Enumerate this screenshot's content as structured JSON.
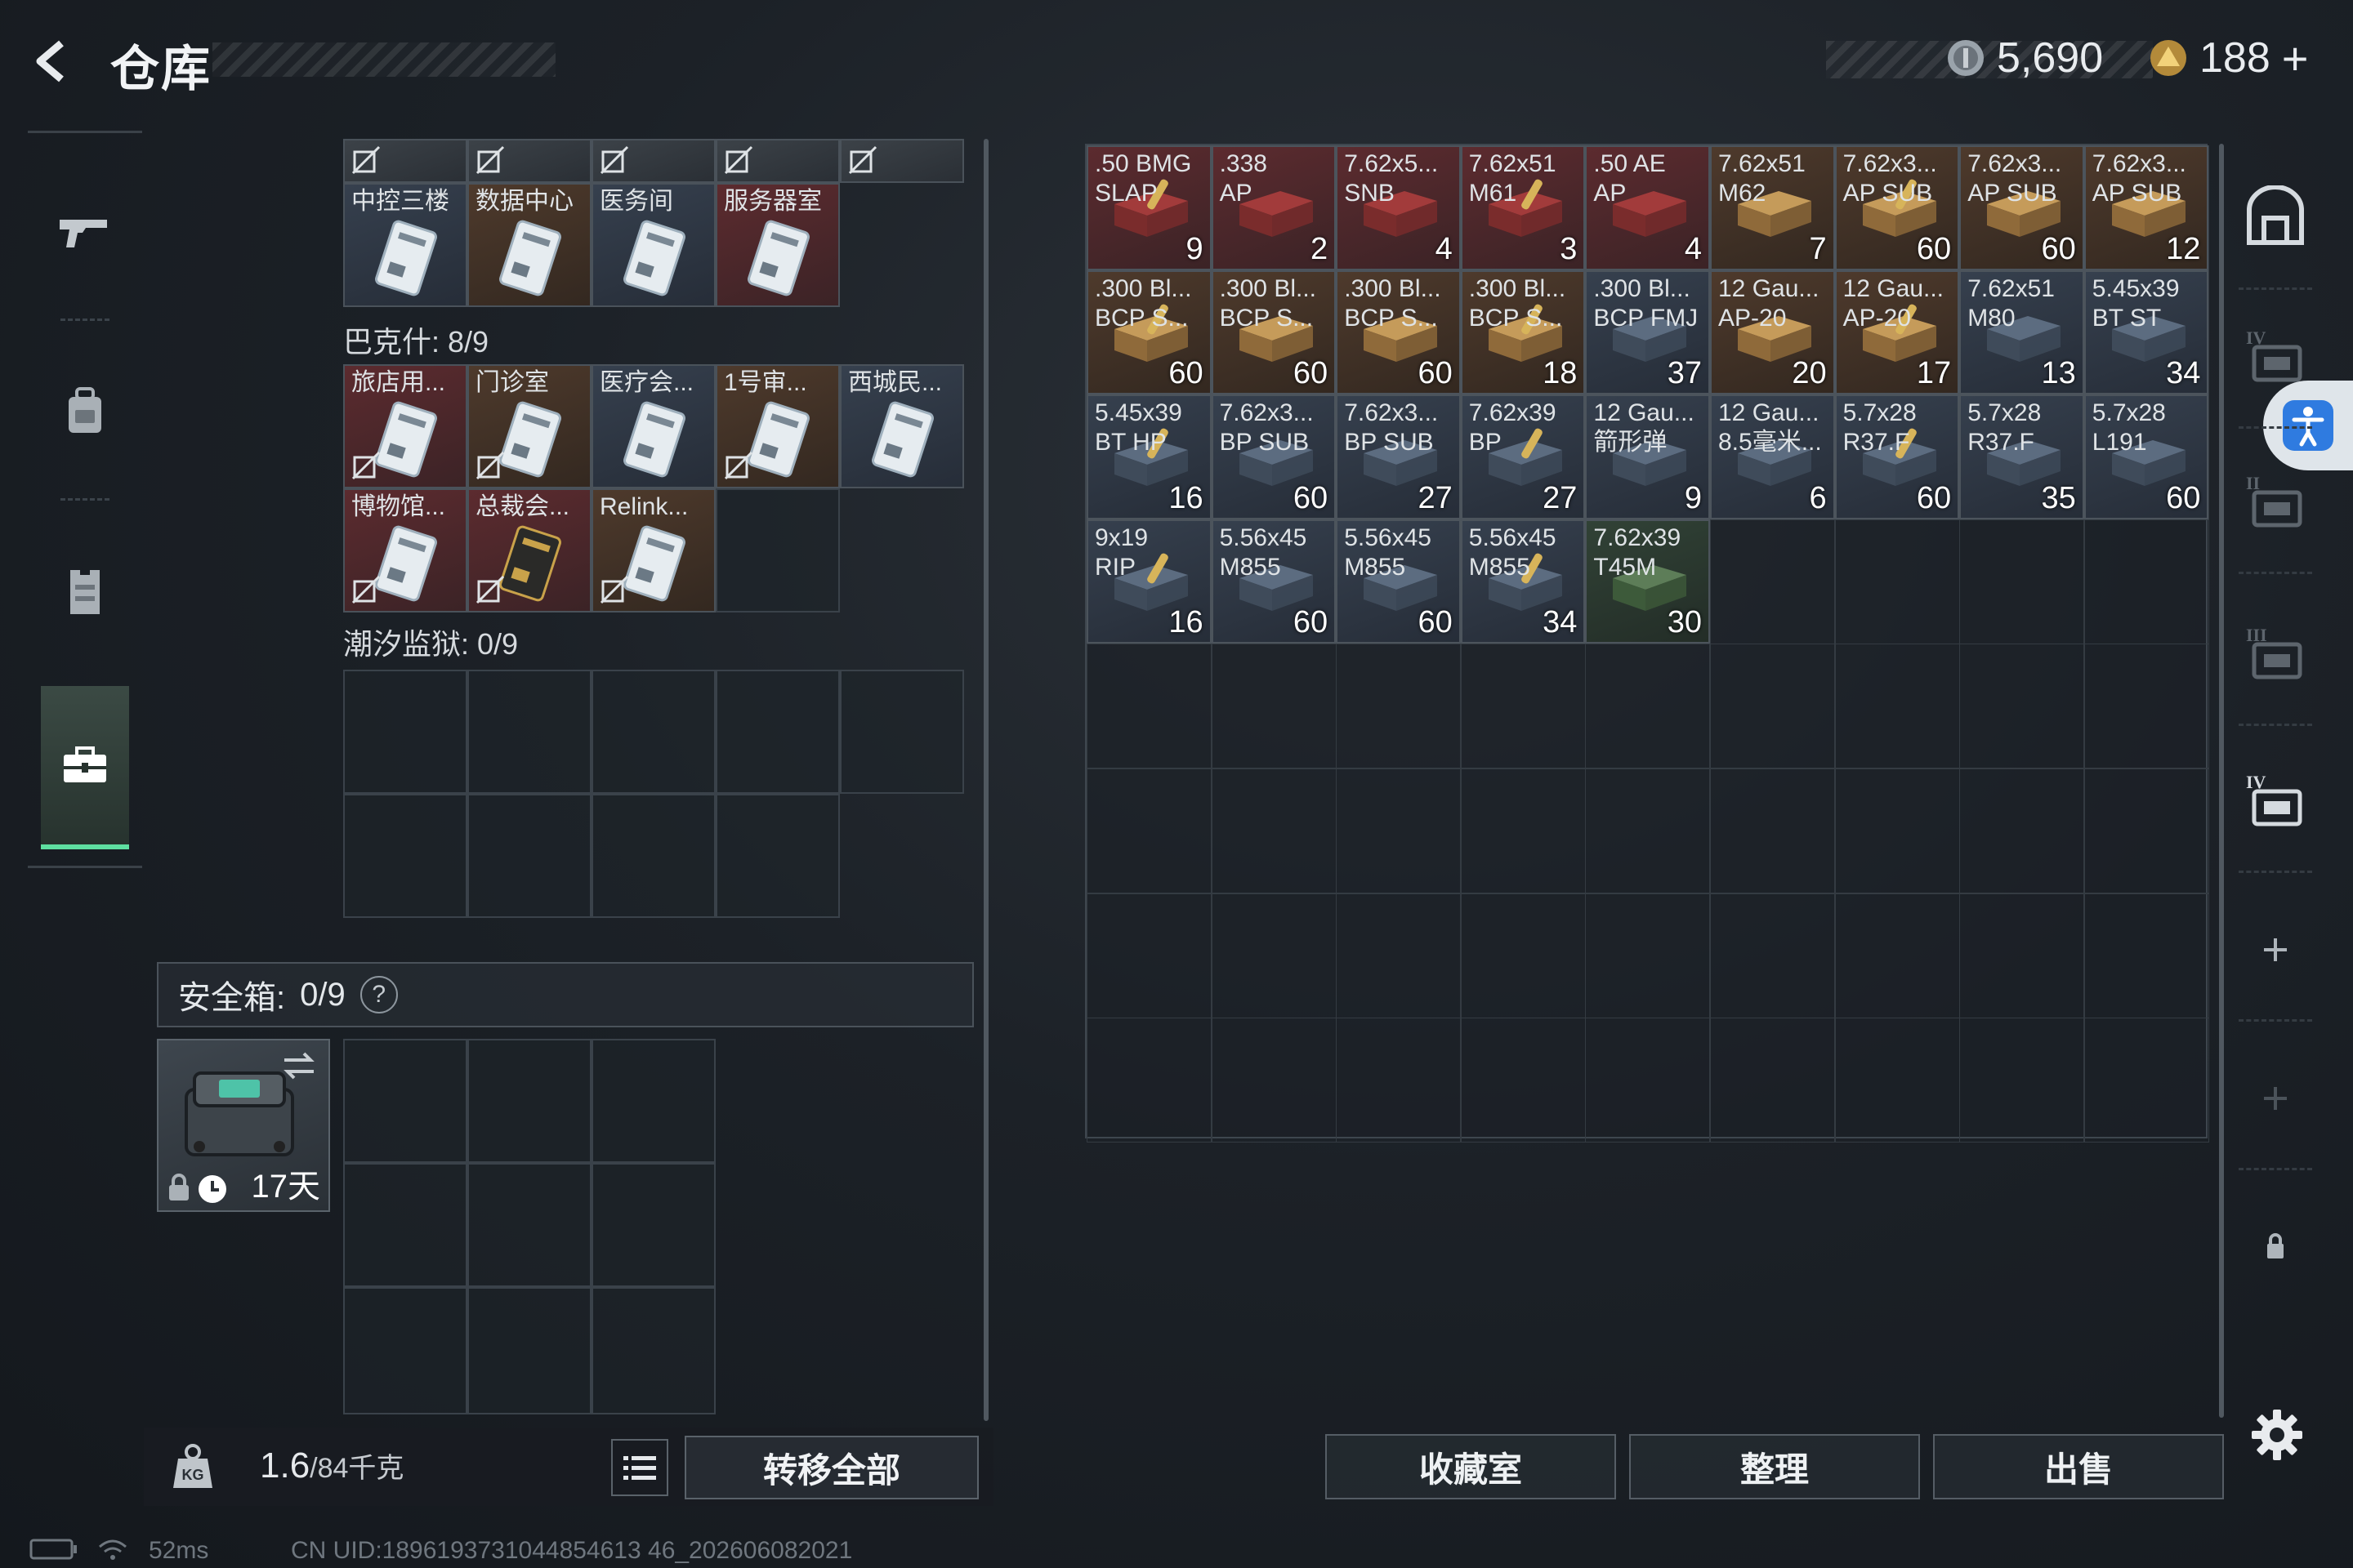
{
  "header": {
    "title": "仓库",
    "currencies": [
      {
        "icon": "silver-coin-icon",
        "value": "5,690"
      },
      {
        "icon": "gold-triangle-coin-icon",
        "value": "188"
      }
    ],
    "add_symbol": "+"
  },
  "left_nav": {
    "items": [
      {
        "icon": "gun-icon"
      },
      {
        "icon": "backpack-icon"
      },
      {
        "icon": "vest-icon"
      },
      {
        "icon": "briefcase-icon",
        "active": true
      }
    ]
  },
  "keycards": {
    "top_row_labels": [
      "中控三楼",
      "数据中心",
      "医务间",
      "服务器室"
    ],
    "sections": [
      {
        "title": "巴克什: 8/9",
        "cards": [
          {
            "label": "旅店用...",
            "bg": "red"
          },
          {
            "label": "门诊室",
            "bg": "brown"
          },
          {
            "label": "医疗会...",
            "bg": "blue"
          },
          {
            "label": "1号审...",
            "bg": "brown"
          },
          {
            "label": "西城民...",
            "bg": "blue"
          },
          {
            "label": "博物馆...",
            "bg": "red"
          },
          {
            "label": "总裁会...",
            "bg": "red"
          },
          {
            "label": "Relink...",
            "bg": "brown"
          }
        ]
      },
      {
        "title": "潮汐监狱: 0/9",
        "cards": []
      }
    ]
  },
  "safebox": {
    "label": "安全箱:",
    "count": "0/9",
    "help": "?",
    "days": "17天"
  },
  "bottom_left": {
    "weight_value": "1.6",
    "weight_max": "/84千克",
    "transfer_all": "转移全部"
  },
  "ammo": [
    {
      "line1": ".50 BMG",
      "line2": "SLAP",
      "qty": "9",
      "bg": "red"
    },
    {
      "line1": ".338",
      "line2": "AP",
      "qty": "2",
      "bg": "red"
    },
    {
      "line1": "7.62x5...",
      "line2": "SNB",
      "qty": "4",
      "bg": "red"
    },
    {
      "line1": "7.62x51",
      "line2": "M61",
      "qty": "3",
      "bg": "red"
    },
    {
      "line1": ".50 AE",
      "line2": "AP",
      "qty": "4",
      "bg": "red"
    },
    {
      "line1": "7.62x51",
      "line2": "M62",
      "qty": "7",
      "bg": "brown"
    },
    {
      "line1": "7.62x3...",
      "line2": "AP SUB",
      "qty": "60",
      "bg": "brown"
    },
    {
      "line1": "7.62x3...",
      "line2": "AP SUB",
      "qty": "60",
      "bg": "brown"
    },
    {
      "line1": "7.62x3...",
      "line2": "AP SUB",
      "qty": "12",
      "bg": "brown"
    },
    {
      "line1": ".300 Bl...",
      "line2": "BCP S...",
      "qty": "60",
      "bg": "brown"
    },
    {
      "line1": ".300 Bl...",
      "line2": "BCP S...",
      "qty": "60",
      "bg": "brown"
    },
    {
      "line1": ".300 Bl...",
      "line2": "BCP S...",
      "qty": "60",
      "bg": "brown"
    },
    {
      "line1": ".300 Bl...",
      "line2": "BCP S...",
      "qty": "18",
      "bg": "brown"
    },
    {
      "line1": ".300 Bl...",
      "line2": "BCP FMJ",
      "qty": "37",
      "bg": "blue"
    },
    {
      "line1": "12 Gau...",
      "line2": "AP-20",
      "qty": "20",
      "bg": "brown"
    },
    {
      "line1": "12 Gau...",
      "line2": "AP-20",
      "qty": "17",
      "bg": "brown"
    },
    {
      "line1": "7.62x51",
      "line2": "M80",
      "qty": "13",
      "bg": "blue"
    },
    {
      "line1": "5.45x39",
      "line2": "BT ST",
      "qty": "34",
      "bg": "blue"
    },
    {
      "line1": "5.45x39",
      "line2": "BT HP",
      "qty": "16",
      "bg": "blue"
    },
    {
      "line1": "7.62x3...",
      "line2": "BP SUB",
      "qty": "60",
      "bg": "blue"
    },
    {
      "line1": "7.62x3...",
      "line2": "BP SUB",
      "qty": "27",
      "bg": "blue"
    },
    {
      "line1": "7.62x39",
      "line2": "BP",
      "qty": "27",
      "bg": "blue"
    },
    {
      "line1": "12 Gau...",
      "line2": "箭形弹",
      "qty": "9",
      "bg": "blue"
    },
    {
      "line1": "12 Gau...",
      "line2": "8.5毫米...",
      "qty": "6",
      "bg": "blue"
    },
    {
      "line1": "5.7x28",
      "line2": "R37.F",
      "qty": "60",
      "bg": "blue"
    },
    {
      "line1": "5.7x28",
      "line2": "R37.F",
      "qty": "35",
      "bg": "blue"
    },
    {
      "line1": "5.7x28",
      "line2": "L191",
      "qty": "60",
      "bg": "blue"
    },
    {
      "line1": "9x19",
      "line2": "RIP",
      "qty": "16",
      "bg": "blue"
    },
    {
      "line1": "5.56x45",
      "line2": "M855",
      "qty": "60",
      "bg": "blue"
    },
    {
      "line1": "5.56x45",
      "line2": "M855",
      "qty": "60",
      "bg": "blue"
    },
    {
      "line1": "5.56x45",
      "line2": "M855",
      "qty": "34",
      "bg": "blue"
    },
    {
      "line1": "7.62x39",
      "line2": "T45M",
      "qty": "30",
      "bg": "green"
    }
  ],
  "right_sidebar": [
    {
      "icon": "vault-icon"
    },
    {
      "icon": "level-iv-storage-icon",
      "label": "IV"
    },
    {
      "icon": "level-ii-medkit-icon",
      "label": "II"
    },
    {
      "icon": "level-iii-gun-rack-icon",
      "label": "III"
    },
    {
      "icon": "level-iv-cabinet-icon",
      "label": "IV"
    },
    {
      "icon": "add-icon"
    },
    {
      "icon": "add-icon"
    },
    {
      "icon": "lock-icon"
    }
  ],
  "bottom_buttons": {
    "collection": "收藏室",
    "organize": "整理",
    "sell": "出售"
  },
  "status_bar": {
    "ping": "52ms",
    "uid": "CN UID:1896193731044854613 46_202606082021"
  },
  "colors": {
    "accent_green": "#5ee0a0",
    "rarity_red": "#5c2b2f",
    "rarity_brown": "#4e3a2c",
    "rarity_blue": "#36404e",
    "rarity_green": "#314236"
  }
}
